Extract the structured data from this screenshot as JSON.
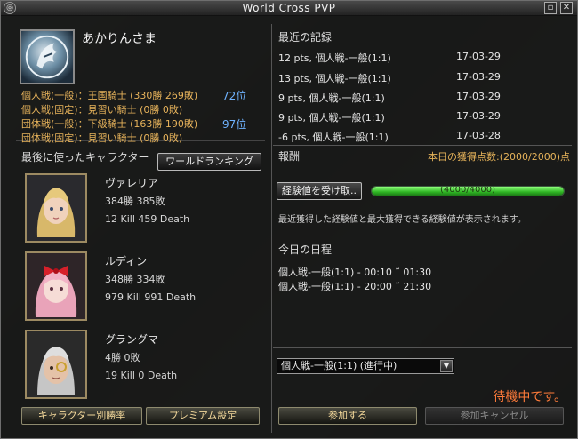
{
  "window": {
    "title": "World Cross PVP"
  },
  "profile": {
    "name": "あかりんさま",
    "ranks": [
      {
        "text": "個人戦(一般)：王国騎士 (330勝 269敗)",
        "rank": "72位"
      },
      {
        "text": "個人戦(固定)：見習い騎士 (0勝 0敗)",
        "rank": ""
      },
      {
        "text": "団体戦(一般)：下級騎士 (163勝 190敗)",
        "rank": "97位"
      },
      {
        "text": "団体戦(固定)：見習い騎士 (0勝 0敗)",
        "rank": ""
      }
    ]
  },
  "left": {
    "last_used_label": "最後に使ったキャラクター",
    "ranking_button": "ワールドランキング",
    "characters": [
      {
        "name": "ヴァレリア",
        "wl": "384勝 385敗",
        "kd": "12 Kill 459 Death"
      },
      {
        "name": "ルディン",
        "wl": "348勝 334敗",
        "kd": "979 Kill 991 Death"
      },
      {
        "name": "グラングマ",
        "wl": "4勝 0敗",
        "kd": "19 Kill 0 Death"
      }
    ],
    "winrate_button": "キャラクター別勝率",
    "premium_button": "プレミアム設定"
  },
  "records": {
    "title": "最近の記録",
    "rows": [
      {
        "desc": "12 pts, 個人戦-一般(1:1)",
        "date": "17-03-29"
      },
      {
        "desc": "13 pts, 個人戦-一般(1:1)",
        "date": "17-03-29"
      },
      {
        "desc": "9 pts, 個人戦-一般(1:1)",
        "date": "17-03-29"
      },
      {
        "desc": "9 pts, 個人戦-一般(1:1)",
        "date": "17-03-29"
      },
      {
        "desc": "-6 pts, 個人戦-一般(1:1)",
        "date": "17-03-28"
      }
    ]
  },
  "reward": {
    "title": "報酬",
    "daily": "本日の獲得点数:(2000/2000)点",
    "exp_button": "経験値を受け取..",
    "exp_text": "(4000/4000)",
    "exp_progress": 1.0,
    "desc": "最近獲得した経験値と最大獲得できる経験値が表示されます。"
  },
  "schedule": {
    "title": "今日の日程",
    "items": [
      "個人戦-一般(1:1) - 00:10 ˜ 01:30",
      "個人戦-一般(1:1) - 20:00 ˜ 21:30"
    ]
  },
  "queue": {
    "selected": "個人戦-一般(1:1) (進行中)",
    "status": "待機中です。",
    "join_button": "参加する",
    "cancel_button": "参加キャンセル"
  }
}
